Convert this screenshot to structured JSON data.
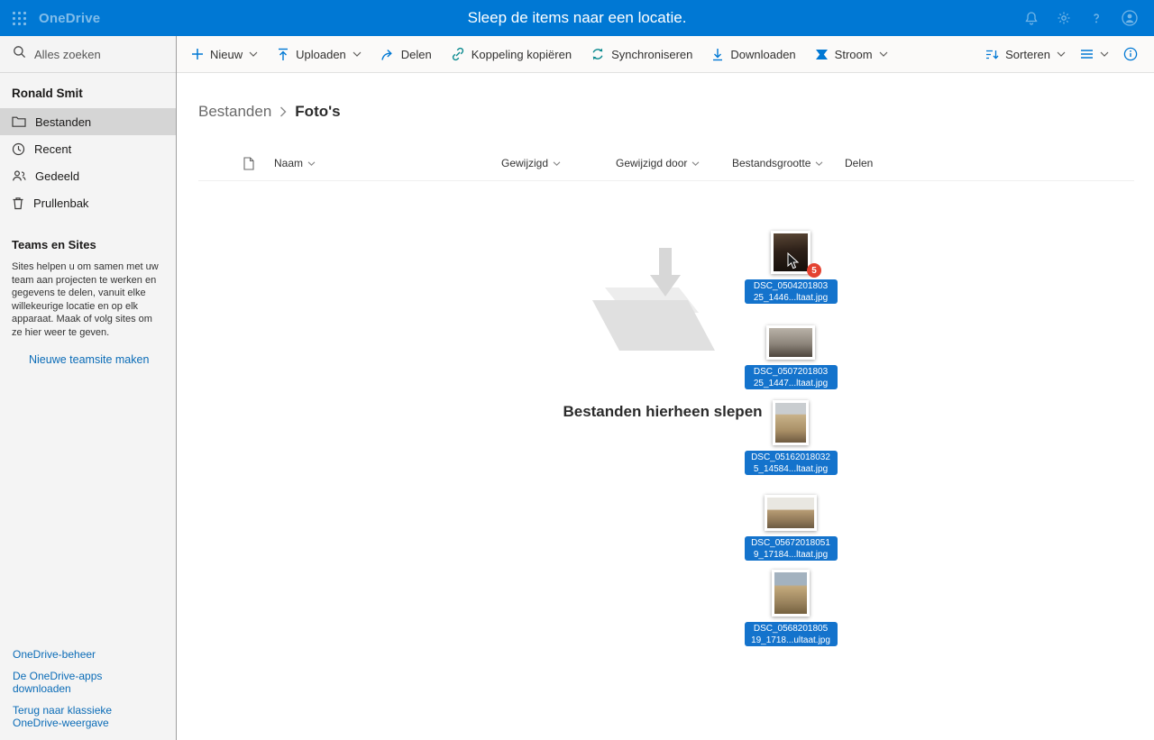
{
  "colors": {
    "topbar": "#0078d4",
    "drag_label_bg": "#1473cc",
    "badge_bg": "#e44332",
    "link_blue": "#0b6cb7"
  },
  "topbar": {
    "app_name": "OneDrive",
    "drag_message": "Sleep de items naar een locatie.",
    "right_icons": [
      "notifications-bell-icon",
      "settings-gear-icon",
      "help-icon",
      "account-avatar-icon"
    ]
  },
  "toolbar": {
    "items": [
      "Nieuw",
      "Uploaden",
      "Delen",
      "Koppeling kopiëren",
      "Synchroniseren",
      "Downloaden",
      "Stroom"
    ],
    "sort_label": "Sorteren",
    "icons": [
      "plus-icon",
      "upload-icon",
      "share-icon",
      "link-icon",
      "sync-icon",
      "download-icon",
      "flow-icon",
      "sort-icon",
      "view-options-icon",
      "info-icon"
    ]
  },
  "sidebar": {
    "search_placeholder": "Alles zoeken",
    "user_name": "Ronald Smit",
    "nav": [
      {
        "label": "Bestanden",
        "icon": "folder-icon",
        "selected": true
      },
      {
        "label": "Recent",
        "icon": "clock-icon",
        "selected": false
      },
      {
        "label": "Gedeeld",
        "icon": "people-icon",
        "selected": false
      },
      {
        "label": "Prullenbak",
        "icon": "trash-icon",
        "selected": false
      }
    ],
    "teams_heading": "Teams en Sites",
    "teams_text": "Sites helpen u om samen met uw team aan projecten te werken en gegevens te delen, vanuit elke willekeurige locatie en op elk apparaat. Maak of volg sites om ze hier weer te geven.",
    "teams_link": "Nieuwe teamsite maken",
    "footer_links": [
      "OneDrive-beheer",
      "De OneDrive-apps downloaden",
      "Terug naar klassieke OneDrive-weergave"
    ]
  },
  "main": {
    "breadcrumb": [
      "Bestanden",
      "Foto's"
    ],
    "columns": [
      "Naam",
      "Gewijzigd",
      "Gewijzigd door",
      "Bestandsgrootte",
      "Delen"
    ],
    "drop_text": "Bestanden hierheen slepen",
    "drag_badge_count": "5",
    "dragged_files": [
      {
        "name_line1": "DSC_0504201803",
        "name_line2": "25_1446...ltaat.jpg"
      },
      {
        "name_line1": "DSC_0507201803",
        "name_line2": "25_1447...ltaat.jpg"
      },
      {
        "name_line1": "DSC_05162018032",
        "name_line2": "5_14584...ltaat.jpg"
      },
      {
        "name_line1": "DSC_05672018051",
        "name_line2": "9_17184...ltaat.jpg"
      },
      {
        "name_line1": "DSC_0568201805",
        "name_line2": "19_1718...ultaat.jpg"
      }
    ]
  }
}
